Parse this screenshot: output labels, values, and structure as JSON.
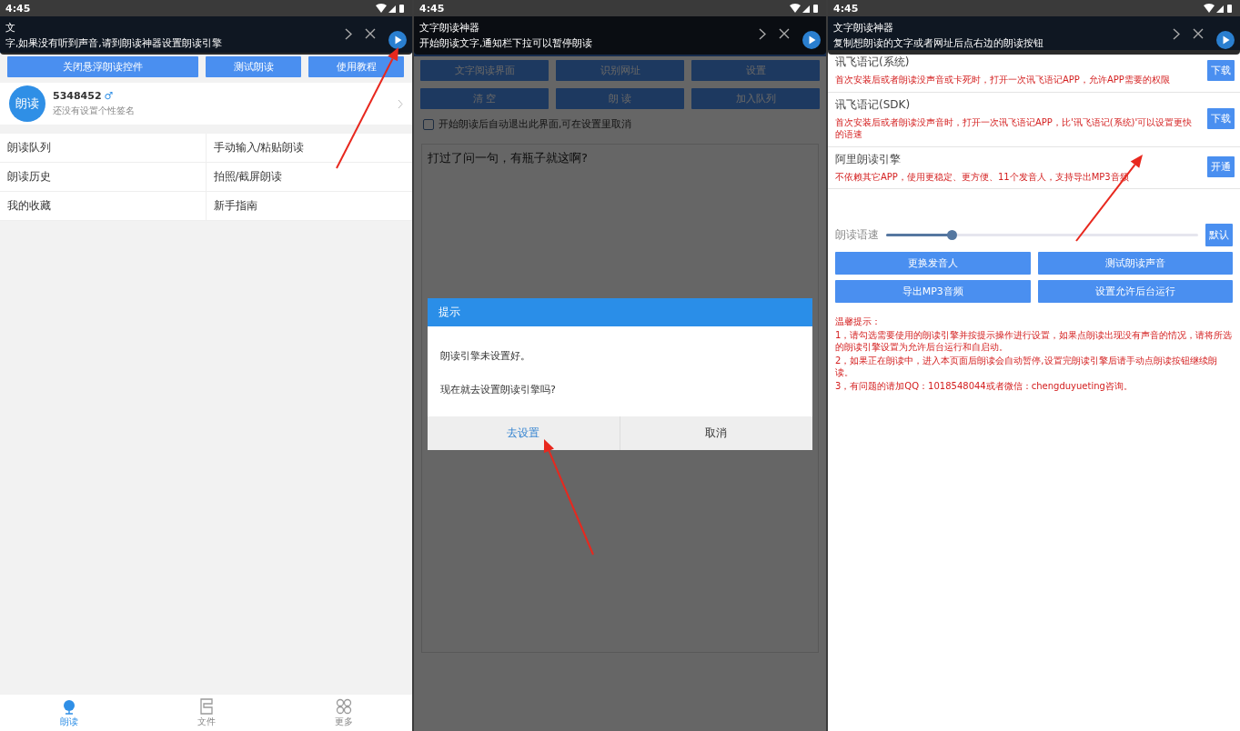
{
  "screens": [
    {
      "kind": "home",
      "status_time": "4:45",
      "notification": {
        "title": "文",
        "text": "字,如果没有听到声音,请到朗读神器设置朗读引擎"
      },
      "buttons": [
        "关闭悬浮朗读控件",
        "测试朗读",
        "使用教程"
      ],
      "profile": {
        "avatar_text": "朗读",
        "name": "5348452",
        "gender": "♂",
        "signature": "还没有设置个性签名"
      },
      "menu": [
        {
          "label": "朗读队列"
        },
        {
          "label": "手动输入/粘贴朗读"
        },
        {
          "label": "朗读历史"
        },
        {
          "label": "拍照/截屏朗读"
        },
        {
          "label": "我的收藏"
        },
        {
          "label": "新手指南"
        }
      ],
      "tabs": [
        {
          "label": "朗读",
          "selected": true
        },
        {
          "label": "文件",
          "selected": false
        },
        {
          "label": "更多",
          "selected": false
        }
      ]
    },
    {
      "kind": "reader",
      "status_time": "4:45",
      "notification": {
        "title": "文字朗读神器",
        "text": "开始朗读文字,通知栏下拉可以暂停朗读"
      },
      "buttons": [
        "文字阅读界面",
        "识别网址",
        "设置",
        "清 空",
        "朗 读",
        "加入队列"
      ],
      "checkbox": {
        "label": "开始朗读后自动退出此界面,可在设置里取消",
        "checked": false
      },
      "text": "打过了问一句，有瓶子就这啊?",
      "dialog": {
        "title": "提示",
        "lines": [
          "朗读引擎未设置好。",
          "现在就去设置朗读引擎吗?"
        ],
        "buttons": [
          {
            "label": "去设置",
            "kind": "confirm"
          },
          {
            "label": "取消",
            "kind": "cancel"
          }
        ]
      }
    },
    {
      "kind": "engines",
      "status_time": "4:45",
      "notification": {
        "title": "文字朗读神器",
        "text": "复制想朗读的文字或者网址后点右边的朗读按钮"
      },
      "engines": [
        {
          "name": "讯飞语记(系统)",
          "description": "首次安装后或者朗读没声音或卡死时，打开一次讯飞语记APP，允许APP需要的权限",
          "action": "下载"
        },
        {
          "name": "讯飞语记(SDK)",
          "description": "首次安装后或者朗读没声音时，打开一次讯飞语记APP，比'讯飞语记(系统)'可以设置更快的语速",
          "action": "下载"
        },
        {
          "name": "阿里朗读引擎",
          "description": "不依赖其它APP，使用更稳定、更方便、11个发音人，支持导出MP3音频",
          "action": "开通"
        }
      ],
      "speed": {
        "label": "朗读语速",
        "level": 0.21,
        "reset": "默认"
      },
      "buttons": [
        "更换发音人",
        "测试朗读声音",
        "导出MP3音频",
        "设置允许后台运行"
      ],
      "tips": [
        "温馨提示：",
        "1，请勾选需要使用的朗读引擎并按提示操作进行设置，如果点朗读出现没有声音的情况，请将所选的朗读引擎设置为允许后台运行和自启动。",
        "2，如果正在朗读中，进入本页面后朗读会自动暂停,设置完朗读引擎后请手动点朗读按钮继续朗读。",
        "3，有问题的请加QQ：1018548044或者微信：chengduyueting咨询。"
      ]
    }
  ]
}
